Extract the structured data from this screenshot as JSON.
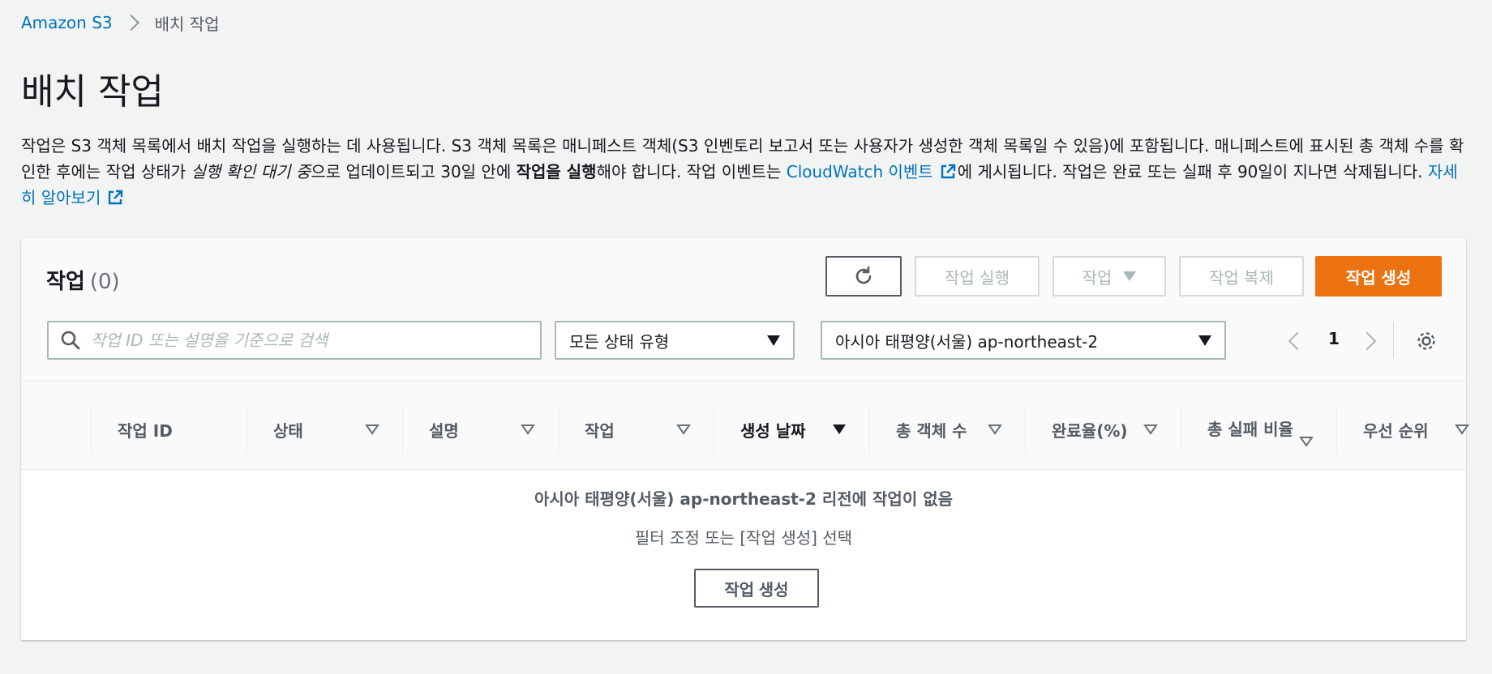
{
  "breadcrumb": {
    "root": "Amazon S3",
    "current": "배치 작업"
  },
  "page": {
    "title": "배치 작업",
    "desc_p1": "작업은 S3 객체 목록에서 배치 작업을 실행하는 데 사용됩니다. S3 객체 목록은 매니페스트 객체(S3 인벤토리 보고서 또는 사용자가 생성한 객체 목록일 수 있음)에 포함됩니다. 매니페스트에 표시된 총 객체 수를 확인한 후에는 작업 상태가 ",
    "desc_italic": "실행 확인 대기 중",
    "desc_p2": "으로 업데이트되고 30일 안에 ",
    "desc_bold": "작업을 실행",
    "desc_p3": "해야 합니다. 작업 이벤트는 ",
    "desc_link1": "CloudWatch 이벤트",
    "desc_p4": "에 게시됩니다. 작업은 완료 또는 실패 후 90일이 지나면 삭제됩니다. ",
    "desc_link2": "자세히 알아보기"
  },
  "panel": {
    "title": "작업",
    "count": "(0)",
    "buttons": {
      "run": "작업 실행",
      "actions": "작업",
      "clone": "작업 복제",
      "create": "작업 생성"
    },
    "search_placeholder": "작업 ID 또는 설명을 기준으로 검색",
    "status_filter": "모든 상태 유형",
    "region_filter": "아시아 태평양(서울) ap-northeast-2",
    "page_number": "1"
  },
  "table": {
    "columns": [
      "작업 ID",
      "상태",
      "설명",
      "작업",
      "생성 날짜",
      "총 객체 수",
      "완료율(%)",
      "총 실패 비율",
      "우선 순위"
    ],
    "sorted_column": "생성 날짜",
    "empty_title": "아시아 태평양(서울) ap-northeast-2 리전에 작업이 없음",
    "empty_sub": "필터 조정 또는 [작업 생성] 선택",
    "empty_button": "작업 생성"
  },
  "colors": {
    "link": "#0073bb",
    "primary": "#ec7211",
    "disabled": "#aab7b8"
  }
}
